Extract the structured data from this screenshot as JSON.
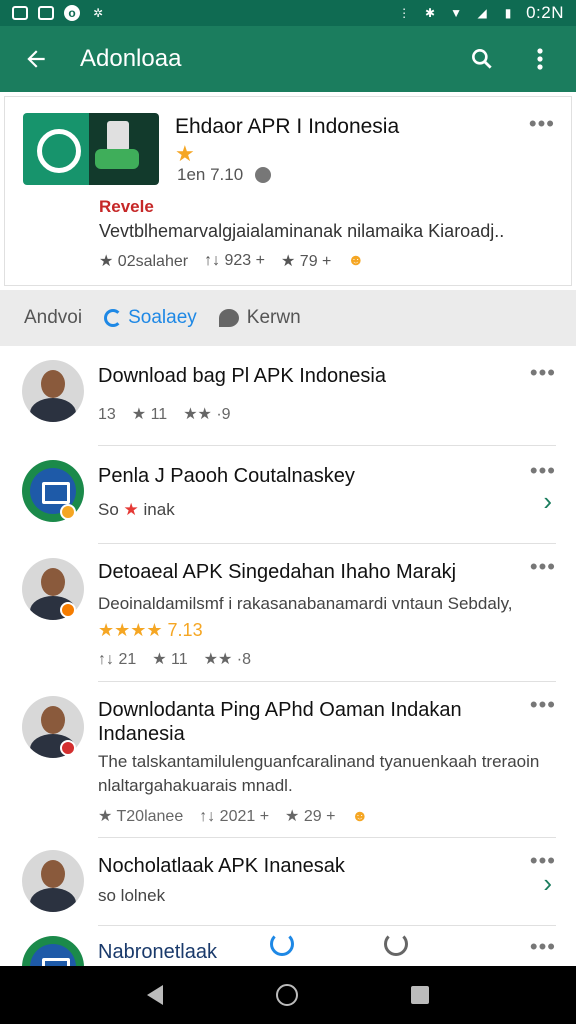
{
  "status_bar": {
    "time": "0:2N",
    "left_icons": [
      "image-icon",
      "mail-icon",
      "circle-icon",
      "settings-icon"
    ],
    "right_icons": [
      "signal-icon",
      "bluetooth-icon",
      "wifi-icon",
      "cell-icon",
      "battery-icon"
    ]
  },
  "appbar": {
    "title": "Adonloaa",
    "back_icon": "back-arrow-icon",
    "search_icon": "search-icon",
    "menu_icon": "more-vert-icon"
  },
  "featured": {
    "title": "Ehdaor APR I Indonesia",
    "meta": "1en 7.10",
    "tag": "Revele",
    "description": "Vevtblhemarvalgjaialaminanak nilamaika Kiaroadj..",
    "stats": [
      "★ 02salaher",
      "↑↓ 923 +",
      "★ 79 +"
    ]
  },
  "filters": {
    "items": [
      "Andvoi",
      "Soalaey",
      "Kerwn"
    ]
  },
  "list": [
    {
      "title": "Download bag Pl APK Indonesia",
      "meta": [
        "13",
        "★ 11",
        "★★ ·9"
      ]
    },
    {
      "title": "Penla J Paooh Coutalnaskey",
      "sub_prefix": "So",
      "sub_suffix": "inak"
    },
    {
      "title": "Detoaeal APK Singedahan Ihaho Marakj",
      "sub": "Deoinaldamilsmf i rakasanabanamardi vntaun Sebdaly,",
      "stars_text": "★★★★ 7.13",
      "meta": [
        "↑↓ 21",
        "★ 11",
        "★★ ·8"
      ]
    },
    {
      "title": "Downlodanta Ping APhd Oaman Indakan Indanesia",
      "sub": "The talskantamilulenguanfcaralinand tyanuenkaah treraoin nlaltargahakuarais mnadl.",
      "meta": [
        "★ T20lanee",
        "↑↓ 2021 +",
        "★ 29 +"
      ]
    },
    {
      "title": "Nocholatlaak APK Inanesak",
      "sub": "so lolnek"
    },
    {
      "title": "Nabronetlaak"
    }
  ]
}
